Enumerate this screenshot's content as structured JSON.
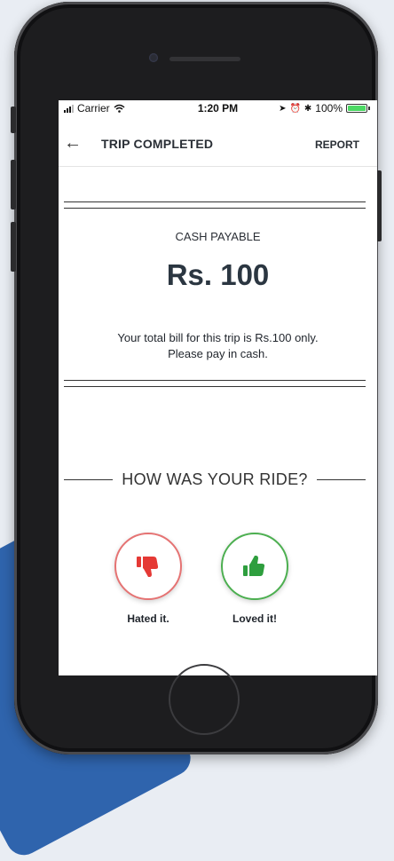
{
  "statusbar": {
    "carrier": "Carrier",
    "time": "1:20 PM",
    "battery": "100%",
    "battery_color": "#4cd964"
  },
  "appbar": {
    "back_icon": "arrow-left-icon",
    "title": "TRIP COMPLETED",
    "report": "REPORT"
  },
  "payment": {
    "label": "CASH PAYABLE",
    "amount": "Rs. 100",
    "message_line1": "Your total bill for this trip is Rs.100 only.",
    "message_line2": "Please pay in cash."
  },
  "rating": {
    "title": "HOW WAS YOUR RIDE?",
    "options": [
      {
        "label": "Hated it.",
        "icon": "thumbs-down-icon",
        "color": "#e53935"
      },
      {
        "label": "Loved it!",
        "icon": "thumbs-up-icon",
        "color": "#2e9e3e"
      }
    ]
  }
}
